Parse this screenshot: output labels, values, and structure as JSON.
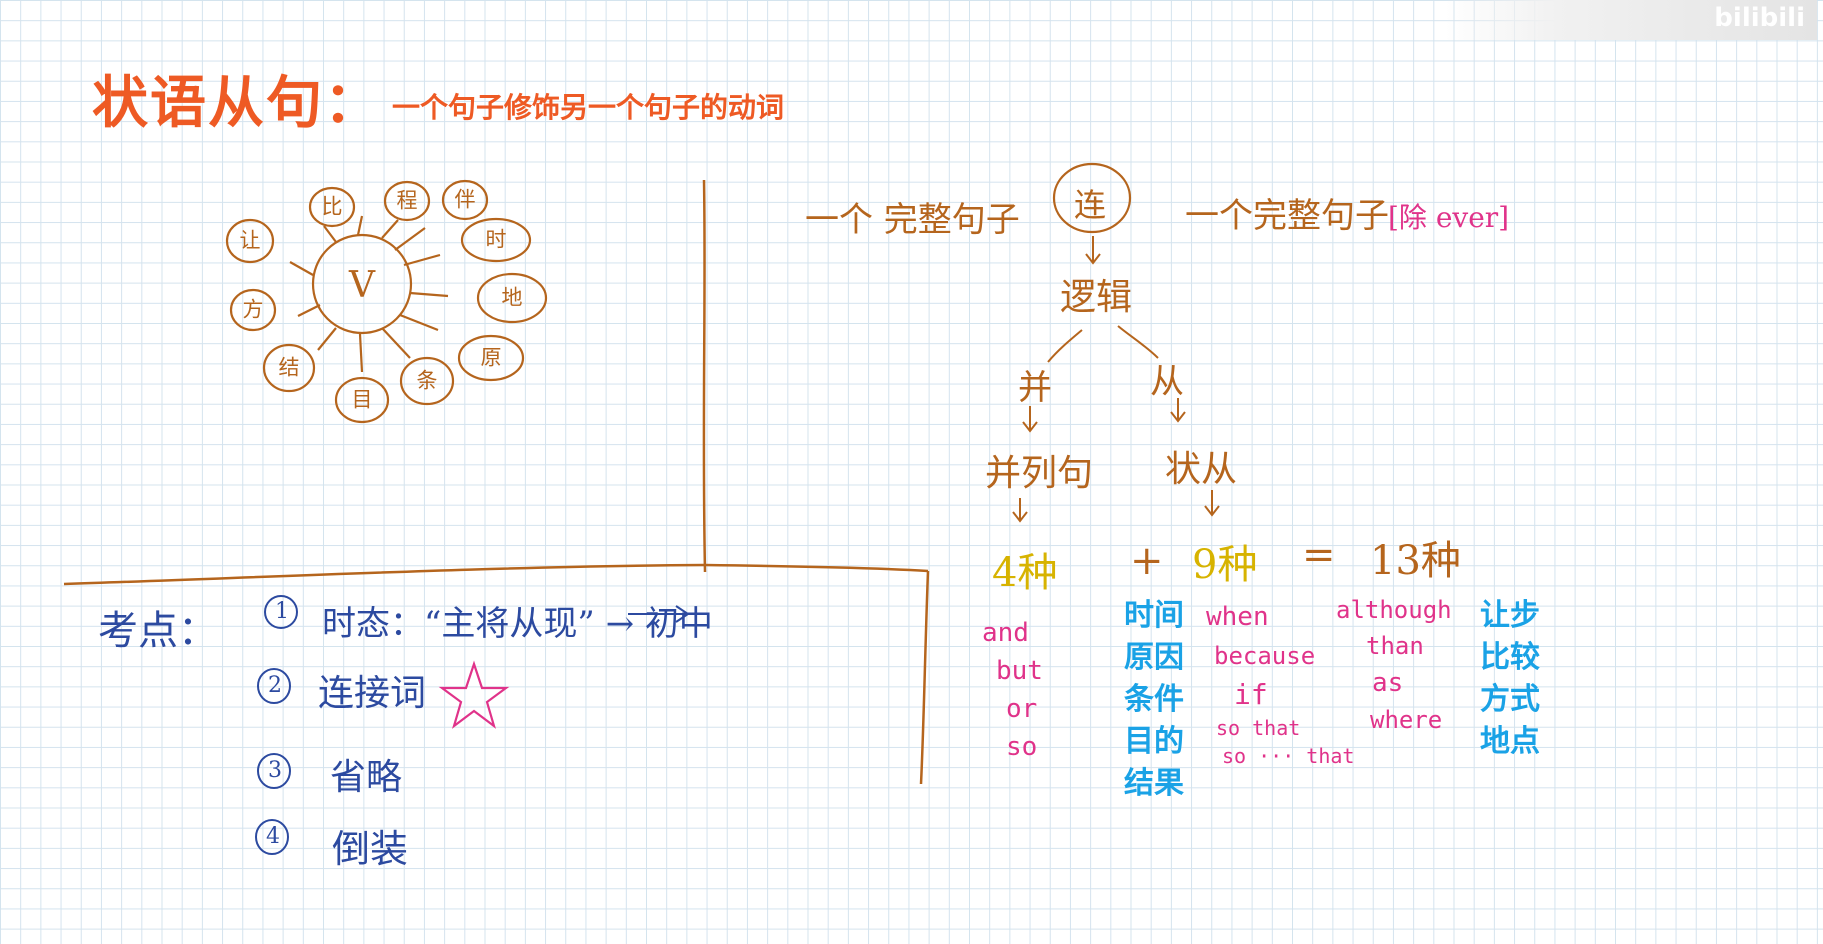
{
  "title": {
    "main": "状语从句：",
    "subtitle": "一个句子修饰另一个句子的动词"
  },
  "mind_map": {
    "center": "V",
    "bubbles": [
      "让",
      "比",
      "程",
      "伴",
      "时",
      "地",
      "原",
      "条",
      "目",
      "结",
      "方"
    ]
  },
  "structure": {
    "left_clause": "一个 完整句子",
    "connector": "连",
    "right_clause": "一个完整句子",
    "right_note": "[除 ever]",
    "logic": "逻辑",
    "branch_left": "并",
    "branch_right": "从",
    "left_result": "并列句",
    "right_result": "状从",
    "count_left": "4种",
    "plus": "+",
    "count_right": "9种",
    "equals": "=",
    "count_total": "13种"
  },
  "coordinating": [
    "and",
    "but",
    "or",
    "so"
  ],
  "adverbial_types_a": [
    "时间",
    "原因",
    "条件",
    "目的",
    "结果"
  ],
  "conjunctions_a": [
    "when",
    "because",
    "if",
    "so that",
    "so ··· that"
  ],
  "conjunctions_b": [
    "although",
    "than",
    "as",
    "where"
  ],
  "adverbial_types_b": [
    "让步",
    "比较",
    "方式",
    "地点"
  ],
  "exam_points": {
    "label": "考点：",
    "items": [
      {
        "num": "①",
        "text": "时态：“主将从现” → 初中"
      },
      {
        "num": "②",
        "text": "连接词"
      },
      {
        "num": "③",
        "text": "省略"
      },
      {
        "num": "④",
        "text": "倒装"
      }
    ],
    "star": "☆"
  },
  "watermark": "bilibili"
}
